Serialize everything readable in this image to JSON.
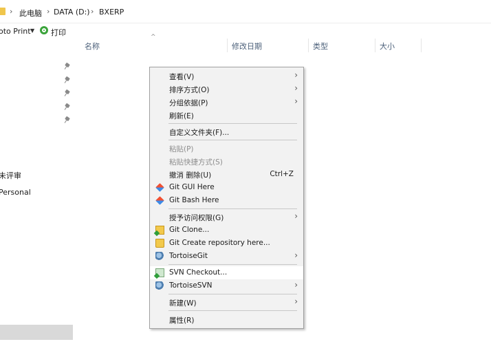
{
  "address_bar": {
    "crumbs": [
      "此电脑",
      "DATA (D:)",
      "BXERP"
    ]
  },
  "toolbar": {
    "photo_print_label": "oto Print",
    "print_label": "打印"
  },
  "nav": {
    "items": [
      "未评审",
      "Personal"
    ]
  },
  "columns": [
    "名称",
    "修改日期",
    "类型",
    "大小"
  ],
  "context_menu": {
    "items": [
      {
        "label": "查看(V)",
        "submenu": true
      },
      {
        "label": "排序方式(O)",
        "submenu": true
      },
      {
        "label": "分组依据(P)",
        "submenu": true
      },
      {
        "label": "刷新(E)"
      },
      {
        "label": "自定义文件夹(F)..."
      },
      {
        "label": "粘贴(P)",
        "disabled": true
      },
      {
        "label": "粘贴快捷方式(S)",
        "disabled": true
      },
      {
        "label": "撤消 删除(U)",
        "shortcut": "Ctrl+Z"
      },
      {
        "label": "Git GUI Here",
        "icon": "git-gui-icon"
      },
      {
        "label": "Git Bash Here",
        "icon": "git-bash-icon"
      },
      {
        "label": "授予访问权限(G)",
        "submenu": true
      },
      {
        "label": "Git Clone...",
        "icon": "git-clone-icon"
      },
      {
        "label": "Git Create repository here...",
        "icon": "git-create-repo-icon"
      },
      {
        "label": "TortoiseGit",
        "icon": "tortoisegit-icon",
        "submenu": true
      },
      {
        "label": "SVN Checkout...",
        "icon": "svn-checkout-icon",
        "highlighted": true
      },
      {
        "label": "TortoiseSVN",
        "icon": "tortoisesvn-icon",
        "submenu": true
      },
      {
        "label": "新建(W)",
        "submenu": true
      },
      {
        "label": "属性(R)"
      }
    ]
  }
}
